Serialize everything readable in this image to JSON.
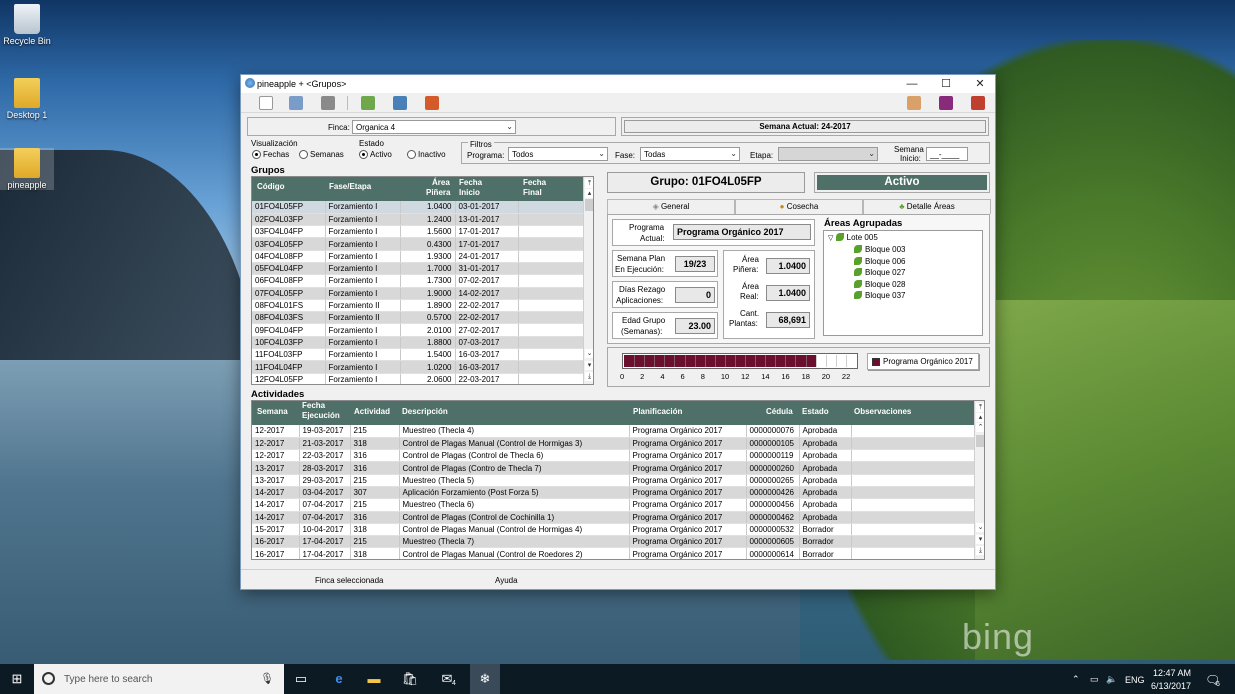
{
  "desktop": {
    "icons": [
      {
        "label": "Recycle Bin"
      },
      {
        "label": "Desktop 1"
      },
      {
        "label": "pineapple"
      }
    ],
    "watermark": "bing"
  },
  "window": {
    "title": "pineapple + <Grupos>",
    "controls": {
      "minimize": "—",
      "maximize": "☐",
      "close": "✕"
    }
  },
  "filters": {
    "finca_label": "Finca:",
    "finca_value": "Organica 4",
    "semana_actual": "Semana Actual: 24-2017",
    "visualizacion_label": "Visualización",
    "fechas_label": "Fechas",
    "semanas_label": "Semanas",
    "estado_label": "Estado",
    "activo_label": "Activo",
    "inactivo_label": "Inactivo",
    "filtros_label": "Filtros",
    "programa_label": "Programa:",
    "programa_value": "Todos",
    "fase_label": "Fase:",
    "fase_value": "Todas",
    "etapa_label": "Etapa:",
    "etapa_value": "",
    "semana_inicio_label_1": "Semana",
    "semana_inicio_label_2": "Inicio:",
    "semana_inicio_value": "__-____"
  },
  "grupos": {
    "title": "Grupos",
    "headers": {
      "codigo": "Código",
      "fase": "Fase/Etapa",
      "area1": "Área",
      "area2": "Piñera",
      "fi1": "Fecha",
      "fi2": "Inicio",
      "ff1": "Fecha",
      "ff2": "Final"
    },
    "rows": [
      [
        "01FO4L05FP",
        "Forzamiento I",
        "1.0400",
        "03-01-2017",
        ""
      ],
      [
        "02FO4L03FP",
        "Forzamiento I",
        "1.2400",
        "13-01-2017",
        ""
      ],
      [
        "03FO4L04FP",
        "Forzamiento I",
        "1.5600",
        "17-01-2017",
        ""
      ],
      [
        "03FO4L05FP",
        "Forzamiento I",
        "0.4300",
        "17-01-2017",
        ""
      ],
      [
        "04FO4L08FP",
        "Forzamiento I",
        "1.9300",
        "24-01-2017",
        ""
      ],
      [
        "05FO4L04FP",
        "Forzamiento I",
        "1.7000",
        "31-01-2017",
        ""
      ],
      [
        "06FO4L08FP",
        "Forzamiento I",
        "1.7300",
        "07-02-2017",
        ""
      ],
      [
        "07FO4L05FP",
        "Forzamiento I",
        "1.9000",
        "14-02-2017",
        ""
      ],
      [
        "08FO4L01FS",
        "Forzamiento II",
        "1.8900",
        "22-02-2017",
        ""
      ],
      [
        "08FO4L03FS",
        "Forzamiento II",
        "0.5700",
        "22-02-2017",
        ""
      ],
      [
        "09FO4L04FP",
        "Forzamiento I",
        "2.0100",
        "27-02-2017",
        ""
      ],
      [
        "10FO4L03FP",
        "Forzamiento I",
        "1.8800",
        "07-03-2017",
        ""
      ],
      [
        "11FO4L03FP",
        "Forzamiento I",
        "1.5400",
        "16-03-2017",
        ""
      ],
      [
        "11FO4L04FP",
        "Forzamiento I",
        "1.0200",
        "16-03-2017",
        ""
      ],
      [
        "12FO4L05FP",
        "Forzamiento I",
        "2.0600",
        "22-03-2017",
        ""
      ]
    ]
  },
  "detail": {
    "grupo": "Grupo: 01FO4L05FP",
    "estado": "Activo",
    "tabs": [
      "General",
      "Cosecha",
      "Detalle Áreas"
    ],
    "programa_label_1": "Programa",
    "programa_label_2": "Actual:",
    "programa_value": "Programa Orgánico 2017",
    "semana_plan_label_1": "Semana Plan",
    "semana_plan_label_2": "En Ejecución:",
    "semana_plan_value": "19/23",
    "dias_rezago_label_1": "Días Rezago",
    "dias_rezago_label_2": "Aplicaciones:",
    "dias_rezago_value": "0",
    "edad_label_1": "Edad Grupo",
    "edad_label_2": "(Semanas):",
    "edad_value": "23.00",
    "area_pinera_label_1": "Área",
    "area_pinera_label_2": "Piñera:",
    "area_pinera_value": "1.0400",
    "area_real_label_1": "Área",
    "area_real_label_2": "Real:",
    "area_real_value": "1.0400",
    "cant_plantas_label_1": "Cant.",
    "cant_plantas_label_2": "Plantas:",
    "cant_plantas_value": "68,691",
    "areas_title": "Áreas Agrupadas",
    "tree_root": "Lote 005",
    "tree_children": [
      "Bloque 003",
      "Bloque 006",
      "Bloque 027",
      "Bloque 028",
      "Bloque 037"
    ],
    "progress": {
      "value": 19,
      "max": 23,
      "ticks": [
        "0",
        "2",
        "4",
        "6",
        "8",
        "10",
        "12",
        "14",
        "16",
        "18",
        "20",
        "22"
      ],
      "legend": "Programa Orgánico 2017",
      "color": "#6b0f2e"
    }
  },
  "actividades": {
    "title": "Actividades",
    "headers": {
      "semana": "Semana",
      "fe1": "Fecha",
      "fe2": "Ejecución",
      "actividad": "Actividad",
      "descripcion": "Descripción",
      "planificacion": "Planificación",
      "cedula": "Cédula",
      "estado": "Estado",
      "observaciones": "Observaciones"
    },
    "rows": [
      [
        "12-2017",
        "19-03-2017",
        "215",
        "Muestreo (Thecla 4)",
        "Programa Orgánico 2017",
        "0000000076",
        "Aprobada",
        ""
      ],
      [
        "12-2017",
        "21-03-2017",
        "318",
        "Control de Plagas Manual (Control de Hormigas 3)",
        "Programa Orgánico 2017",
        "0000000105",
        "Aprobada",
        ""
      ],
      [
        "12-2017",
        "22-03-2017",
        "316",
        "Control de Plagas (Control de Thecla 6)",
        "Programa Orgánico 2017",
        "0000000119",
        "Aprobada",
        ""
      ],
      [
        "13-2017",
        "28-03-2017",
        "316",
        "Control de Plagas (Contro de Thecla 7)",
        "Programa Orgánico 2017",
        "0000000260",
        "Aprobada",
        ""
      ],
      [
        "13-2017",
        "29-03-2017",
        "215",
        "Muestreo (Thecla 5)",
        "Programa Orgánico 2017",
        "0000000265",
        "Aprobada",
        ""
      ],
      [
        "14-2017",
        "03-04-2017",
        "307",
        "Aplicación Forzamiento (Post Forza 5)",
        "Programa Orgánico 2017",
        "0000000426",
        "Aprobada",
        ""
      ],
      [
        "14-2017",
        "07-04-2017",
        "215",
        "Muestreo (Thecla 6)",
        "Programa Orgánico 2017",
        "0000000456",
        "Aprobada",
        ""
      ],
      [
        "14-2017",
        "07-04-2017",
        "316",
        "Control de Plagas (Control de Cochinilla 1)",
        "Programa Orgánico 2017",
        "0000000462",
        "Aprobada",
        ""
      ],
      [
        "15-2017",
        "10-04-2017",
        "318",
        "Control de Plagas Manual (Control de Hormigas 4)",
        "Programa Orgánico 2017",
        "0000000532",
        "Borrador",
        ""
      ],
      [
        "16-2017",
        "17-04-2017",
        "215",
        "Muestreo (Thecla 7)",
        "Programa Orgánico 2017",
        "0000000605",
        "Borrador",
        ""
      ],
      [
        "16-2017",
        "17-04-2017",
        "318",
        "Control de Plagas Manual (Control de Roedores 2)",
        "Programa Orgánico 2017",
        "0000000614",
        "Borrador",
        ""
      ]
    ]
  },
  "statusbar": {
    "left": "Finca seleccionada",
    "right": "Ayuda"
  },
  "taskbar": {
    "search_placeholder": "Type here to search",
    "lang": "ENG",
    "time": "12:47 AM",
    "date": "6/13/2017",
    "notifications": "6",
    "mail_badge": "4"
  }
}
